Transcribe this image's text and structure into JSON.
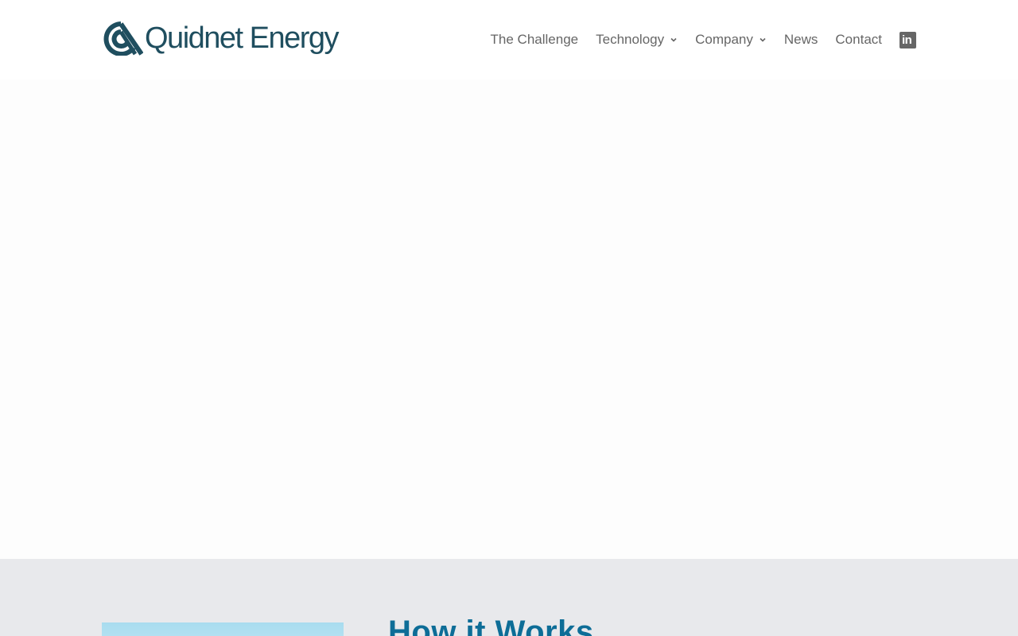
{
  "brand": {
    "name": "Quidnet Energy",
    "color": "#1f4e5f"
  },
  "nav": {
    "items": [
      {
        "label": "The Challenge",
        "has_dropdown": false
      },
      {
        "label": "Technology",
        "has_dropdown": true
      },
      {
        "label": "Company",
        "has_dropdown": true
      },
      {
        "label": "News",
        "has_dropdown": false
      },
      {
        "label": "Contact",
        "has_dropdown": false
      }
    ],
    "social_icon": "linkedin-icon",
    "social_label": "in"
  },
  "section": {
    "title": "How it Works",
    "title_color": "#0d6d97",
    "background": "#e8e9ec"
  }
}
